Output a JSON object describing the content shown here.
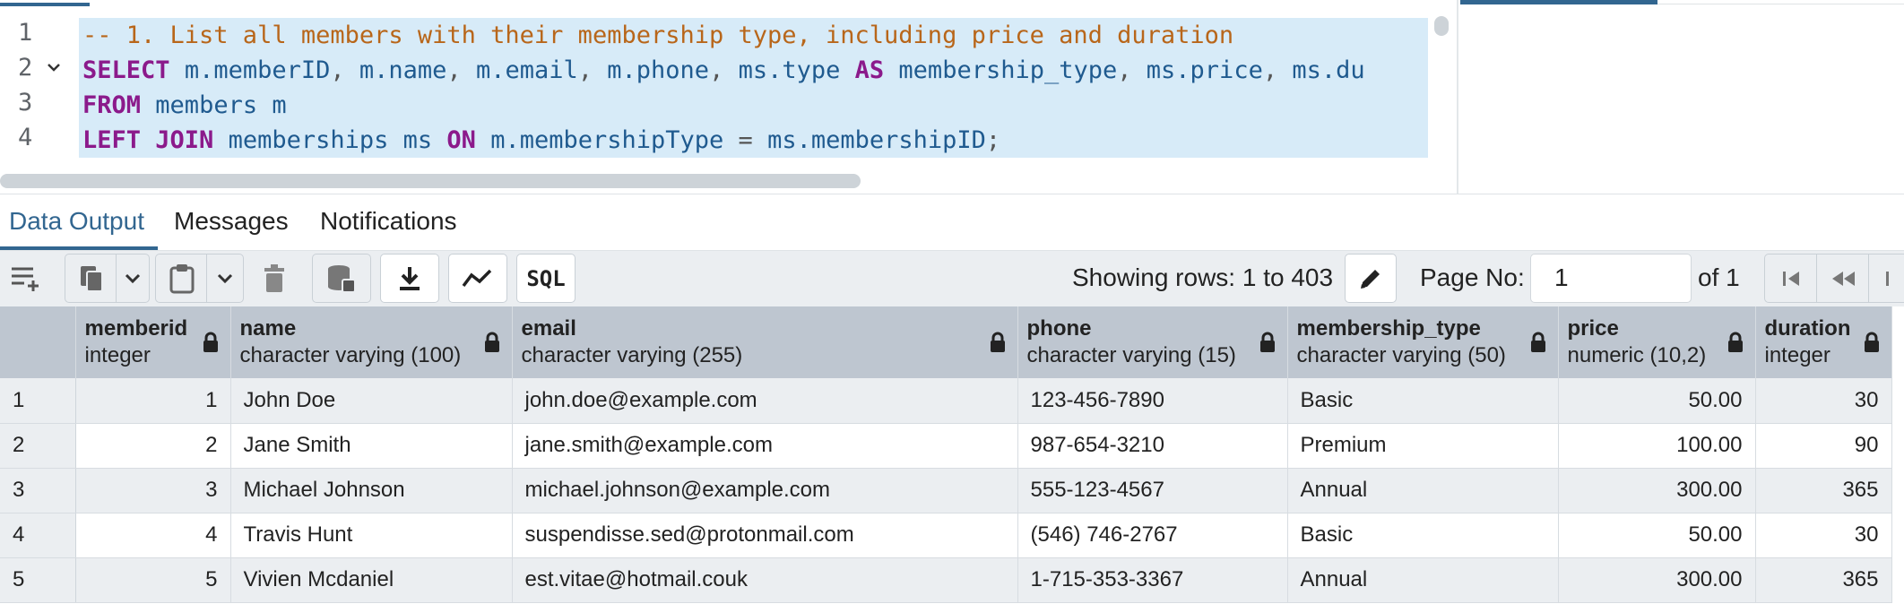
{
  "editor": {
    "line_numbers": [
      "1",
      "2",
      "3",
      "4"
    ],
    "lines": [
      [
        {
          "t": "cm",
          "v": "-- 1. List all members with their membership type, including price and duration"
        }
      ],
      [
        {
          "t": "kw",
          "v": "SELECT"
        },
        {
          "t": "op",
          "v": " "
        },
        {
          "t": "id",
          "v": "m.memberID"
        },
        {
          "t": "op",
          "v": ", "
        },
        {
          "t": "id",
          "v": "m.name"
        },
        {
          "t": "op",
          "v": ", "
        },
        {
          "t": "id",
          "v": "m.email"
        },
        {
          "t": "op",
          "v": ", "
        },
        {
          "t": "id",
          "v": "m.phone"
        },
        {
          "t": "op",
          "v": ", "
        },
        {
          "t": "id",
          "v": "ms.type"
        },
        {
          "t": "op",
          "v": " "
        },
        {
          "t": "kw",
          "v": "AS"
        },
        {
          "t": "op",
          "v": " "
        },
        {
          "t": "id",
          "v": "membership_type"
        },
        {
          "t": "op",
          "v": ", "
        },
        {
          "t": "id",
          "v": "ms.price"
        },
        {
          "t": "op",
          "v": ", "
        },
        {
          "t": "id",
          "v": "ms.du"
        }
      ],
      [
        {
          "t": "kw",
          "v": "FROM"
        },
        {
          "t": "op",
          "v": " "
        },
        {
          "t": "id",
          "v": "members m"
        }
      ],
      [
        {
          "t": "kw",
          "v": "LEFT JOIN"
        },
        {
          "t": "op",
          "v": " "
        },
        {
          "t": "id",
          "v": "memberships ms"
        },
        {
          "t": "op",
          "v": " "
        },
        {
          "t": "kw",
          "v": "ON"
        },
        {
          "t": "op",
          "v": " "
        },
        {
          "t": "id",
          "v": "m.membershipType"
        },
        {
          "t": "op",
          "v": " = "
        },
        {
          "t": "id",
          "v": "ms.membershipID"
        },
        {
          "t": "op",
          "v": ";"
        }
      ]
    ]
  },
  "tabs": [
    "Data Output",
    "Messages",
    "Notifications"
  ],
  "toolbar": {
    "rows_label": "Showing rows: 1 to 403",
    "page_label": "Page No:",
    "page_value": "1",
    "of_label": "of 1",
    "sql_label": "SQL"
  },
  "columns": [
    {
      "name": "memberid",
      "type": "integer"
    },
    {
      "name": "name",
      "type": "character varying (100)"
    },
    {
      "name": "email",
      "type": "character varying (255)"
    },
    {
      "name": "phone",
      "type": "character varying (15)"
    },
    {
      "name": "membership_type",
      "type": "character varying (50)"
    },
    {
      "name": "price",
      "type": "numeric (10,2)"
    },
    {
      "name": "duration",
      "type": "integer"
    }
  ],
  "rows": [
    [
      "1",
      "1",
      "John Doe",
      "john.doe@example.com",
      "123-456-7890",
      "Basic",
      "50.00",
      "30"
    ],
    [
      "2",
      "2",
      "Jane Smith",
      "jane.smith@example.com",
      "987-654-3210",
      "Premium",
      "100.00",
      "90"
    ],
    [
      "3",
      "3",
      "Michael Johnson",
      "michael.johnson@example.com",
      "555-123-4567",
      "Annual",
      "300.00",
      "365"
    ],
    [
      "4",
      "4",
      "Travis Hunt",
      "suspendisse.sed@protonmail.com",
      "(546) 746-2767",
      "Basic",
      "50.00",
      "30"
    ],
    [
      "5",
      "5",
      "Vivien Mcdaniel",
      "est.vitae@hotmail.couk",
      "1-715-353-3367",
      "Annual",
      "300.00",
      "365"
    ]
  ],
  "colors": {
    "accent": "#326690",
    "header_bg": "#bec6d0",
    "selection": "#d7ebf8"
  }
}
